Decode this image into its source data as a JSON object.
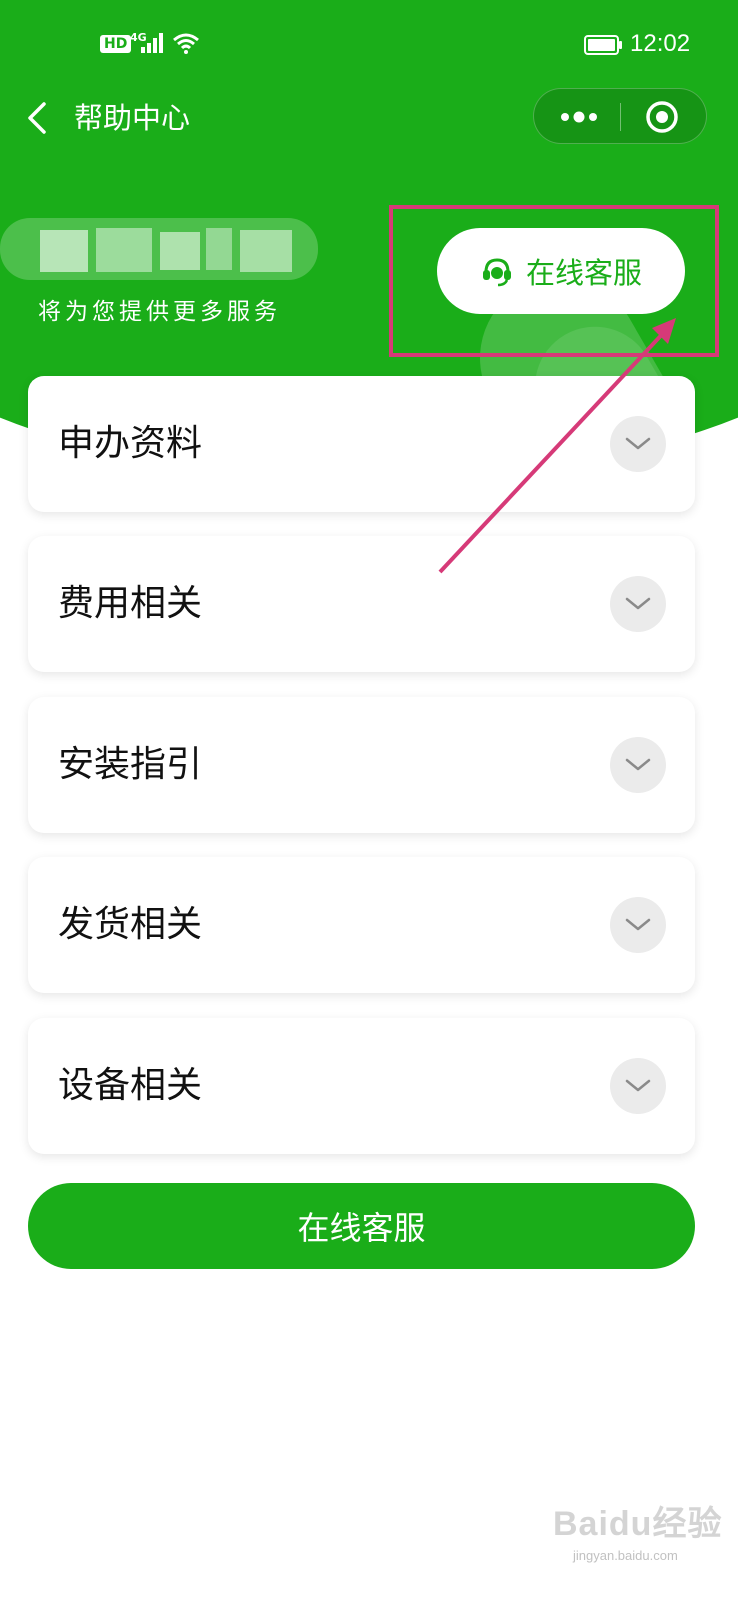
{
  "status_bar": {
    "hd_label": "HD",
    "network_label": "4G",
    "time": "12:02"
  },
  "nav": {
    "title": "帮助中心",
    "back_icon": "chevron-left-icon",
    "more_icon": "more-dots-icon",
    "close_icon": "target-circle-icon"
  },
  "header": {
    "user_name_blurred": "",
    "subtitle": "将为您提供更多服务",
    "service_button": {
      "label": "在线客服",
      "icon": "headset-icon"
    }
  },
  "faq_sections": [
    {
      "label": "申办资料",
      "icon": "chevron-down-icon"
    },
    {
      "label": "费用相关",
      "icon": "chevron-down-icon"
    },
    {
      "label": "安装指引",
      "icon": "chevron-down-icon"
    },
    {
      "label": "发货相关",
      "icon": "chevron-down-icon"
    },
    {
      "label": "设备相关",
      "icon": "chevron-down-icon"
    }
  ],
  "bottom_button": {
    "label": "在线客服"
  },
  "watermark": {
    "main": "Baidu经验",
    "sub": "jingyan.baidu.com"
  },
  "colors": {
    "brand_green": "#1aad19",
    "annotation_pink": "#d63a78",
    "card_bg": "#ffffff",
    "toggle_bg": "#ebebeb"
  }
}
